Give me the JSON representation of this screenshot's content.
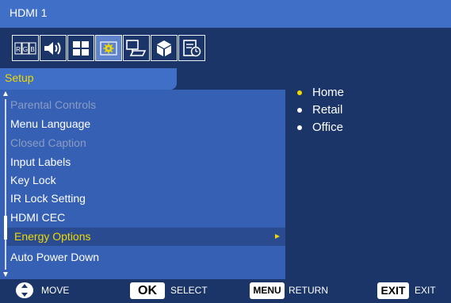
{
  "window": {
    "title": "HDMI 1"
  },
  "icon_tabs": [
    {
      "name": "picture-rgb-icon",
      "selected": false
    },
    {
      "name": "audio-speaker-icon",
      "selected": false
    },
    {
      "name": "screen-grid-icon",
      "selected": false
    },
    {
      "name": "setup-gear-icon",
      "selected": true
    },
    {
      "name": "pc-monitor-icon",
      "selected": false
    },
    {
      "name": "advanced-cube-icon",
      "selected": false
    },
    {
      "name": "schedule-clock-icon",
      "selected": false
    }
  ],
  "menu": {
    "section": "Setup",
    "items": [
      {
        "label": "Parental Controls",
        "enabled": false,
        "selected": false
      },
      {
        "label": "Menu Language",
        "enabled": true,
        "selected": false
      },
      {
        "label": "Closed Caption",
        "enabled": false,
        "selected": false
      },
      {
        "label": "Input Labels",
        "enabled": true,
        "selected": false
      },
      {
        "label": "Key Lock",
        "enabled": true,
        "selected": false
      },
      {
        "label": "IR Lock Setting",
        "enabled": true,
        "selected": false
      },
      {
        "label": "HDMI CEC",
        "enabled": true,
        "selected": false
      },
      {
        "label": "Energy Options",
        "enabled": true,
        "selected": true
      },
      {
        "label": "Auto Power Down",
        "enabled": true,
        "selected": false
      }
    ]
  },
  "options": [
    {
      "label": "Home",
      "selected": true
    },
    {
      "label": "Retail",
      "selected": false
    },
    {
      "label": "Office",
      "selected": false
    }
  ],
  "footer": {
    "move": {
      "key": "",
      "label": "MOVE"
    },
    "select": {
      "key": "OK",
      "label": "SELECT"
    },
    "return": {
      "key": "MENU",
      "label": "RETURN"
    },
    "exit": {
      "key": "EXIT",
      "label": "EXIT"
    }
  },
  "colors": {
    "background": "#1b3568",
    "title_bar": "#3f6fc6",
    "menu_panel": "#3660b4",
    "highlight_text": "#f0d900",
    "disabled_text": "#8a9cc4",
    "selected_row": "#2a4b90"
  }
}
